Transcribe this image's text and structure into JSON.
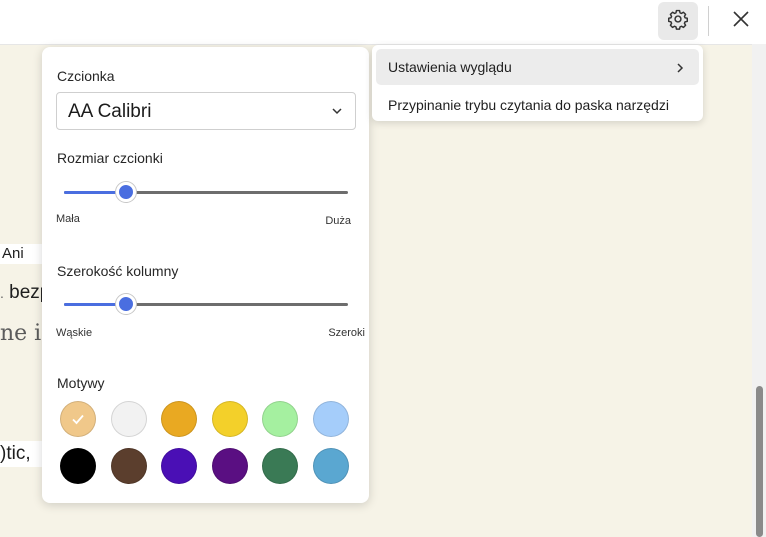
{
  "background_text": {
    "fragment_1": "Ani",
    "fragment_2": "bezpieczeństwo",
    "fragment_3": "ne i",
    "fragment_4": ")tic,"
  },
  "reading_settings": {
    "font_label": "Czcionka",
    "font_value": "AA Calibri",
    "font_size_label": "Rozmiar czcionki",
    "font_size_min": "Mała",
    "font_size_max": "Duża",
    "font_size_level": 0.22,
    "column_width_label": "Szerokość kolumny",
    "column_width_min": "Wąskie",
    "column_width_max": "Szeroki",
    "column_width_level": 0.22,
    "themes_label": "Motywy",
    "selected_theme": 0,
    "themes": [
      "#f0c88a",
      "#f2f2f2",
      "#e9a922",
      "#f3d02a",
      "#a5f0a0",
      "#a5cdfa",
      "#000000",
      "#5b3e2d",
      "#4a0fb5",
      "#5a0f82",
      "#3a7a55",
      "#5aa7d1"
    ],
    "accent_color": "#4a6ee0"
  },
  "menu": {
    "items": [
      {
        "label": "Ustawienia wyglądu"
      },
      {
        "label": "Przypinanie trybu czytania do paska narzędzi"
      }
    ]
  },
  "toolbar": {
    "settings_icon": "gear-icon",
    "close_icon": "close-icon"
  }
}
